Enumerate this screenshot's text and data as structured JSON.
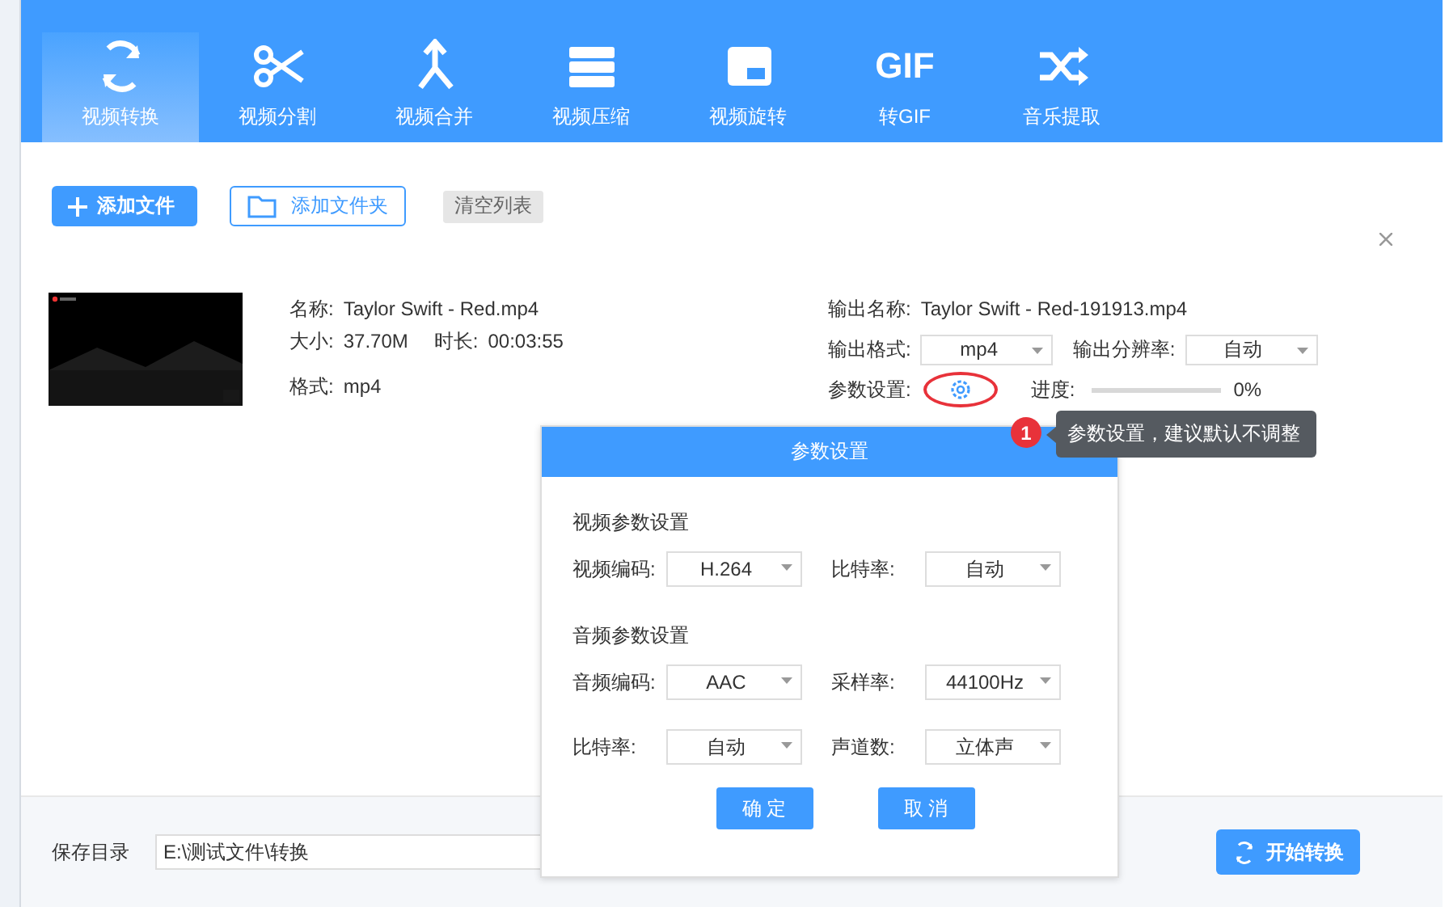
{
  "tabs": [
    {
      "label": "视频转换",
      "selected": true
    },
    {
      "label": "视频分割",
      "selected": false
    },
    {
      "label": "视频合并",
      "selected": false
    },
    {
      "label": "视频压缩",
      "selected": false
    },
    {
      "label": "视频旋转",
      "selected": false
    },
    {
      "label": "转GIF",
      "selected": false,
      "icon_text": "GIF"
    },
    {
      "label": "音乐提取",
      "selected": false
    }
  ],
  "toolbar": {
    "add_file": "添加文件",
    "add_folder": "添加文件夹",
    "clear_list": "清空列表"
  },
  "file": {
    "name_label": "名称:",
    "name": "Taylor Swift - Red.mp4",
    "size_label": "大小:",
    "size": "37.70M",
    "duration_label": "时长:",
    "duration": "00:03:55",
    "format_label": "格式:",
    "format": "mp4",
    "output_name_label": "输出名称:",
    "output_name": "Taylor Swift - Red-191913.mp4",
    "output_format_label": "输出格式:",
    "output_format": "mp4",
    "output_resolution_label": "输出分辨率:",
    "output_resolution": "自动",
    "params_label": "参数设置:",
    "progress_label": "进度:",
    "progress": {
      "level": 0
    },
    "progress_text": "0%"
  },
  "tooltip": {
    "badge": "1",
    "text": "参数设置，建议默认不调整"
  },
  "dialog": {
    "title": "参数设置",
    "sections": [
      {
        "title": "视频参数设置",
        "rows": [
          [
            {
              "label": "视频编码:",
              "value": "H.264"
            },
            {
              "label": "比特率:",
              "value": "自动"
            }
          ]
        ]
      },
      {
        "title": "音频参数设置",
        "rows": [
          [
            {
              "label": "音频编码:",
              "value": "AAC"
            },
            {
              "label": "采样率:",
              "value": "44100Hz"
            }
          ],
          [
            {
              "label": "比特率:",
              "value": "自动"
            },
            {
              "label": "声道数:",
              "value": "立体声"
            }
          ]
        ]
      }
    ],
    "buttons": [
      "确 定",
      "取 消"
    ]
  },
  "footer": {
    "save_dir_label": "保存目录",
    "save_dir": "E:\\测试文件\\转换",
    "start_button": "开始转换"
  }
}
